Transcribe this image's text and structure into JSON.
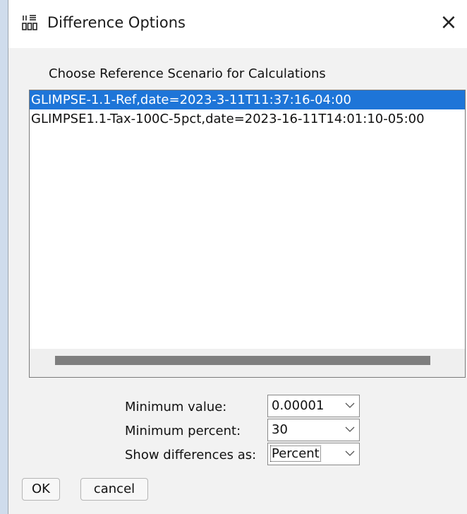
{
  "window": {
    "title": "Difference Options"
  },
  "prompt": "Choose Reference Scenario for Calculations",
  "scenarios": [
    {
      "label": "GLIMPSE-1.1-Ref,date=2023-3-11T11:37:16-04:00",
      "selected": true
    },
    {
      "label": "GLIMPSE1.1-Tax-100C-5pct,date=2023-16-11T14:01:10-05:00",
      "selected": false
    }
  ],
  "form": {
    "min_value": {
      "label": "Minimum value:",
      "value": "0.00001"
    },
    "min_percent": {
      "label": "Minimum percent:",
      "value": "30"
    },
    "show_as": {
      "label": "Show differences as:",
      "value": "Percent"
    }
  },
  "buttons": {
    "ok": "OK",
    "cancel": "cancel"
  },
  "colors": {
    "selection": "#1e75d8",
    "dialog_bg": "#f2f2f2"
  },
  "icons": {
    "app": "app-icon",
    "close": "close-icon",
    "dropdown": "chevron-down-icon"
  }
}
